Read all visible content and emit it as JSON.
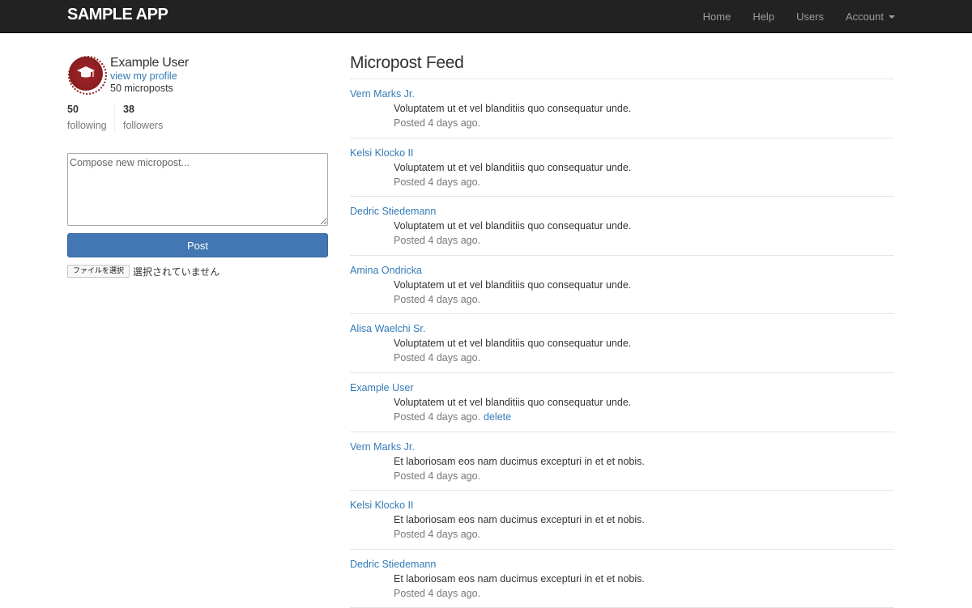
{
  "navbar": {
    "brand": "SAMPLE APP",
    "links": [
      "Home",
      "Help",
      "Users",
      "Account"
    ]
  },
  "sidebar": {
    "user_name": "Example User",
    "profile_link": "view my profile",
    "post_count": "50 microposts",
    "following_count": "50",
    "following_label": "following",
    "followers_count": "38",
    "followers_label": "followers",
    "compose_placeholder": "Compose new micropost...",
    "post_button": "Post",
    "file_button": "ファイルを選択",
    "file_status": "選択されていません"
  },
  "feed": {
    "title": "Micropost Feed",
    "items": [
      {
        "author": "Vern Marks Jr.",
        "content": "Voluptatem ut et vel blanditiis quo consequatur unde.",
        "time": "Posted 4 days ago."
      },
      {
        "author": "Kelsi Klocko II",
        "content": "Voluptatem ut et vel blanditiis quo consequatur unde.",
        "time": "Posted 4 days ago."
      },
      {
        "author": "Dedric Stiedemann",
        "content": "Voluptatem ut et vel blanditiis quo consequatur unde.",
        "time": "Posted 4 days ago."
      },
      {
        "author": "Amina Ondricka",
        "content": "Voluptatem ut et vel blanditiis quo consequatur unde.",
        "time": "Posted 4 days ago."
      },
      {
        "author": "Alisa Waelchi Sr.",
        "content": "Voluptatem ut et vel blanditiis quo consequatur unde.",
        "time": "Posted 4 days ago."
      },
      {
        "author": "Example User",
        "content": "Voluptatem ut et vel blanditiis quo consequatur unde.",
        "time": "Posted 4 days ago.",
        "delete": "delete"
      },
      {
        "author": "Vern Marks Jr.",
        "content": "Et laboriosam eos nam ducimus excepturi in et et nobis.",
        "time": "Posted 4 days ago."
      },
      {
        "author": "Kelsi Klocko II",
        "content": "Et laboriosam eos nam ducimus excepturi in et et nobis.",
        "time": "Posted 4 days ago."
      },
      {
        "author": "Dedric Stiedemann",
        "content": "Et laboriosam eos nam ducimus excepturi in et et nobis.",
        "time": "Posted 4 days ago."
      }
    ]
  },
  "colors": {
    "navbar_bg": "#222222",
    "link": "#337ab7",
    "button": "#4277b3",
    "avatar": "#8d1f22"
  },
  "icons": {
    "avatar": "graduation-cap-icon",
    "account_menu": "caret-down-icon"
  }
}
